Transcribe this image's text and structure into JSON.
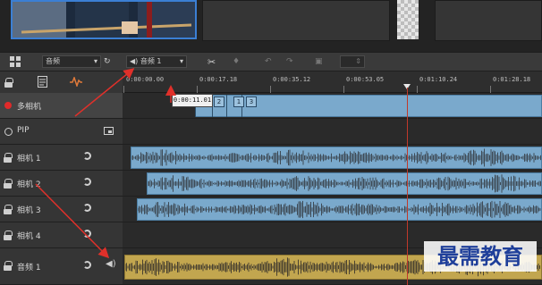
{
  "toolbar": {
    "track_select": "音频",
    "audio_select": "音频 1"
  },
  "timeline": {
    "timecodes": [
      "0:00:00.00",
      "0:00:17.18",
      "0:00:35.12",
      "0:00:53.05",
      "0:01:10.24",
      "0:01:28.18"
    ],
    "tooltip": "0:00:11.01",
    "multicam_markers": [
      "1",
      "2",
      "3"
    ]
  },
  "tracks": [
    {
      "name": "多相机",
      "icon": "record-dot-icon"
    },
    {
      "name": "PIP",
      "icon": "radio-circle-icon"
    },
    {
      "name": "相机 1",
      "icon": "lock-icon"
    },
    {
      "name": "相机 2",
      "icon": "lock-icon"
    },
    {
      "name": "相机 3",
      "icon": "lock-icon"
    },
    {
      "name": "相机 4",
      "icon": "lock-icon"
    },
    {
      "name": "音频 1",
      "icon": "lock-icon"
    }
  ],
  "watermark": "最需教育",
  "colors": {
    "clip_blue": "#7aa9cc",
    "audio_gold": "#c2a64f",
    "annotation_red": "#e0302a",
    "playhead": "#c0392b"
  }
}
